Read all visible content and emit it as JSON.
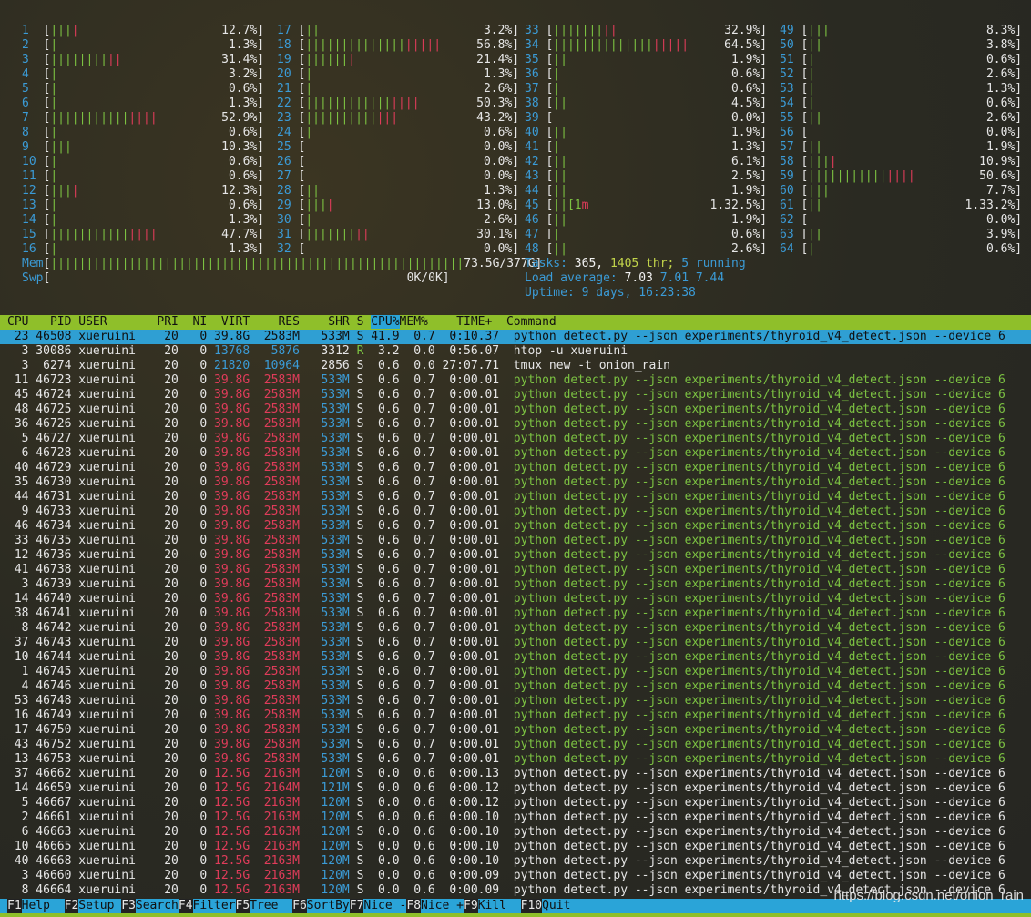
{
  "app_title": "htop",
  "cpu_meters": [
    {
      "id": "1",
      "bars": "||||",
      "pct": "12.7%]"
    },
    {
      "id": "2",
      "bars": "|",
      "pct": "1.3%]"
    },
    {
      "id": "3",
      "bars": "||||||||||",
      "pct": "31.4%]"
    },
    {
      "id": "4",
      "bars": "|",
      "pct": "3.2%]"
    },
    {
      "id": "5",
      "bars": "|",
      "pct": "0.6%]"
    },
    {
      "id": "6",
      "bars": "|",
      "pct": "1.3%]"
    },
    {
      "id": "7",
      "bars": "|||||||||||||||",
      "pct": "52.9%]"
    },
    {
      "id": "8",
      "bars": "|",
      "pct": "0.6%]"
    },
    {
      "id": "9",
      "bars": "|||",
      "pct": "10.3%]"
    },
    {
      "id": "10",
      "bars": "|",
      "pct": "0.6%]"
    },
    {
      "id": "11",
      "bars": "|",
      "pct": "0.6%]"
    },
    {
      "id": "12",
      "bars": "||||",
      "pct": "12.3%]"
    },
    {
      "id": "13",
      "bars": "|",
      "pct": "0.6%]"
    },
    {
      "id": "14",
      "bars": "|",
      "pct": "1.3%]"
    },
    {
      "id": "15",
      "bars": "|||||||||||||||",
      "pct": "47.7%]"
    },
    {
      "id": "16",
      "bars": "|",
      "pct": "1.3%]"
    },
    {
      "id": "17",
      "bars": "||",
      "pct": "3.2%]"
    },
    {
      "id": "18",
      "bars": "|||||||||||||||||||",
      "pct": "56.8%]"
    },
    {
      "id": "19",
      "bars": "|||||||",
      "pct": "21.4%]"
    },
    {
      "id": "20",
      "bars": "|",
      "pct": "1.3%]"
    },
    {
      "id": "21",
      "bars": "|",
      "pct": "2.6%]"
    },
    {
      "id": "22",
      "bars": "||||||||||||||||",
      "pct": "50.3%]"
    },
    {
      "id": "23",
      "bars": "|||||||||||||",
      "pct": "43.2%]"
    },
    {
      "id": "24",
      "bars": "|",
      "pct": "0.6%]"
    },
    {
      "id": "25",
      "bars": "",
      "pct": "0.0%]"
    },
    {
      "id": "26",
      "bars": "",
      "pct": "0.0%]"
    },
    {
      "id": "27",
      "bars": "",
      "pct": "0.0%]"
    },
    {
      "id": "28",
      "bars": "||",
      "pct": "1.3%]"
    },
    {
      "id": "29",
      "bars": "||||",
      "pct": "13.0%]"
    },
    {
      "id": "30",
      "bars": "|",
      "pct": "2.6%]"
    },
    {
      "id": "31",
      "bars": "|||||||||",
      "pct": "30.1%]"
    },
    {
      "id": "32",
      "bars": "",
      "pct": "0.0%]"
    },
    {
      "id": "33",
      "bars": "|||||||||",
      "pct": "32.9%]"
    },
    {
      "id": "34",
      "bars": "|||||||||||||||||||",
      "pct": "64.5%]"
    },
    {
      "id": "35",
      "bars": "||",
      "pct": "1.9%]"
    },
    {
      "id": "36",
      "bars": "|",
      "pct": "0.6%]"
    },
    {
      "id": "37",
      "bars": "|",
      "pct": "0.6%]"
    },
    {
      "id": "38",
      "bars": "||",
      "pct": "4.5%]"
    },
    {
      "id": "39",
      "bars": "",
      "pct": "0.0%]"
    },
    {
      "id": "40",
      "bars": "||",
      "pct": "1.9%]"
    },
    {
      "id": "41",
      "bars": "|",
      "pct": "1.3%]"
    },
    {
      "id": "42",
      "bars": "||",
      "pct": "6.1%]"
    },
    {
      "id": "43",
      "bars": "||",
      "pct": "2.5%]"
    },
    {
      "id": "44",
      "bars": "||",
      "pct": "1.9%]"
    },
    {
      "id": "45",
      "bars": "||[1m",
      "pct": "1.32.5%]"
    },
    {
      "id": "46",
      "bars": "||",
      "pct": "1.9%]"
    },
    {
      "id": "47",
      "bars": "|",
      "pct": "0.6%]"
    },
    {
      "id": "48",
      "bars": "||",
      "pct": "2.6%]"
    },
    {
      "id": "49",
      "bars": "|||",
      "pct": "8.3%]"
    },
    {
      "id": "50",
      "bars": "||",
      "pct": "3.8%]"
    },
    {
      "id": "51",
      "bars": "|",
      "pct": "0.6%]"
    },
    {
      "id": "52",
      "bars": "|",
      "pct": "2.6%]"
    },
    {
      "id": "53",
      "bars": "|",
      "pct": "1.3%]"
    },
    {
      "id": "54",
      "bars": "|",
      "pct": "0.6%]"
    },
    {
      "id": "55",
      "bars": "||",
      "pct": "2.6%]"
    },
    {
      "id": "56",
      "bars": "",
      "pct": "0.0%]"
    },
    {
      "id": "57",
      "bars": "||",
      "pct": "1.9%]"
    },
    {
      "id": "58",
      "bars": "||||",
      "pct": "10.9%]"
    },
    {
      "id": "59",
      "bars": "|||||||||||||||",
      "pct": "50.6%]"
    },
    {
      "id": "60",
      "bars": "|||",
      "pct": "7.7%]"
    },
    {
      "id": "61",
      "bars": "||",
      "pct": "1.33.2%]"
    },
    {
      "id": "62",
      "bars": "",
      "pct": "0.0%]"
    },
    {
      "id": "63",
      "bars": "||",
      "pct": "3.9%]"
    },
    {
      "id": "64",
      "bars": "|",
      "pct": "0.6%]"
    }
  ],
  "mem": {
    "label": "Mem",
    "value": "73.5G/377G]"
  },
  "swp": {
    "label": "Swp",
    "value": "0K/0K]"
  },
  "tasks": {
    "label": "Tasks:",
    "count": "365,",
    "thr": "1405 thr;",
    "running": "5 running"
  },
  "load": {
    "label": "Load average:",
    "l1": "7.03",
    "l5": "7.01",
    "l15": "7.44"
  },
  "uptime": {
    "label": "Uptime:",
    "value": "9 days, 16:23:38"
  },
  "columns": [
    "CPU",
    "PID",
    "USER",
    "PRI",
    "NI",
    "VIRT",
    "RES",
    "SHR",
    "S",
    "CPU%",
    "MEM%",
    "TIME+",
    "Command"
  ],
  "processes": [
    {
      "cpu": "23",
      "pid": "46508",
      "user": "xueruini",
      "pri": "20",
      "ni": "0",
      "virt": "39.8G",
      "res": "2583M",
      "shr": "533M",
      "s": "S",
      "cpup": "41.9",
      "memp": "0.7",
      "time": "0:10.37",
      "cmd": "python detect.py --json experiments/thyroid_v4_detect.json --device 6"
    },
    {
      "cpu": "3",
      "pid": "30086",
      "user": "xueruini",
      "pri": "20",
      "ni": "0",
      "virt": "13768",
      "res": "5876",
      "shr": "3312",
      "s": "R",
      "cpup": "3.2",
      "memp": "0.0",
      "time": "0:56.07",
      "cmd": "htop -u xueruini"
    },
    {
      "cpu": "3",
      "pid": "6274",
      "user": "xueruini",
      "pri": "20",
      "ni": "0",
      "virt": "21820",
      "res": "10964",
      "shr": "2856",
      "s": "S",
      "cpup": "0.6",
      "memp": "0.0",
      "time": "27:07.71",
      "cmd": "tmux new -t onion_rain"
    },
    {
      "cpu": "11",
      "pid": "46723",
      "user": "xueruini",
      "pri": "20",
      "ni": "0",
      "virt": "39.8G",
      "res": "2583M",
      "shr": "533M",
      "s": "S",
      "cpup": "0.6",
      "memp": "0.7",
      "time": "0:00.01",
      "cmd": "python detect.py --json experiments/thyroid_v4_detect.json --device 6"
    },
    {
      "cpu": "45",
      "pid": "46724",
      "user": "xueruini",
      "pri": "20",
      "ni": "0",
      "virt": "39.8G",
      "res": "2583M",
      "shr": "533M",
      "s": "S",
      "cpup": "0.6",
      "memp": "0.7",
      "time": "0:00.01",
      "cmd": "python detect.py --json experiments/thyroid_v4_detect.json --device 6"
    },
    {
      "cpu": "48",
      "pid": "46725",
      "user": "xueruini",
      "pri": "20",
      "ni": "0",
      "virt": "39.8G",
      "res": "2583M",
      "shr": "533M",
      "s": "S",
      "cpup": "0.6",
      "memp": "0.7",
      "time": "0:00.01",
      "cmd": "python detect.py --json experiments/thyroid_v4_detect.json --device 6"
    },
    {
      "cpu": "36",
      "pid": "46726",
      "user": "xueruini",
      "pri": "20",
      "ni": "0",
      "virt": "39.8G",
      "res": "2583M",
      "shr": "533M",
      "s": "S",
      "cpup": "0.6",
      "memp": "0.7",
      "time": "0:00.01",
      "cmd": "python detect.py --json experiments/thyroid_v4_detect.json --device 6"
    },
    {
      "cpu": "5",
      "pid": "46727",
      "user": "xueruini",
      "pri": "20",
      "ni": "0",
      "virt": "39.8G",
      "res": "2583M",
      "shr": "533M",
      "s": "S",
      "cpup": "0.6",
      "memp": "0.7",
      "time": "0:00.01",
      "cmd": "python detect.py --json experiments/thyroid_v4_detect.json --device 6"
    },
    {
      "cpu": "6",
      "pid": "46728",
      "user": "xueruini",
      "pri": "20",
      "ni": "0",
      "virt": "39.8G",
      "res": "2583M",
      "shr": "533M",
      "s": "S",
      "cpup": "0.6",
      "memp": "0.7",
      "time": "0:00.01",
      "cmd": "python detect.py --json experiments/thyroid_v4_detect.json --device 6"
    },
    {
      "cpu": "40",
      "pid": "46729",
      "user": "xueruini",
      "pri": "20",
      "ni": "0",
      "virt": "39.8G",
      "res": "2583M",
      "shr": "533M",
      "s": "S",
      "cpup": "0.6",
      "memp": "0.7",
      "time": "0:00.01",
      "cmd": "python detect.py --json experiments/thyroid_v4_detect.json --device 6"
    },
    {
      "cpu": "35",
      "pid": "46730",
      "user": "xueruini",
      "pri": "20",
      "ni": "0",
      "virt": "39.8G",
      "res": "2583M",
      "shr": "533M",
      "s": "S",
      "cpup": "0.6",
      "memp": "0.7",
      "time": "0:00.01",
      "cmd": "python detect.py --json experiments/thyroid_v4_detect.json --device 6"
    },
    {
      "cpu": "44",
      "pid": "46731",
      "user": "xueruini",
      "pri": "20",
      "ni": "0",
      "virt": "39.8G",
      "res": "2583M",
      "shr": "533M",
      "s": "S",
      "cpup": "0.6",
      "memp": "0.7",
      "time": "0:00.01",
      "cmd": "python detect.py --json experiments/thyroid_v4_detect.json --device 6"
    },
    {
      "cpu": "9",
      "pid": "46733",
      "user": "xueruini",
      "pri": "20",
      "ni": "0",
      "virt": "39.8G",
      "res": "2583M",
      "shr": "533M",
      "s": "S",
      "cpup": "0.6",
      "memp": "0.7",
      "time": "0:00.01",
      "cmd": "python detect.py --json experiments/thyroid_v4_detect.json --device 6"
    },
    {
      "cpu": "46",
      "pid": "46734",
      "user": "xueruini",
      "pri": "20",
      "ni": "0",
      "virt": "39.8G",
      "res": "2583M",
      "shr": "533M",
      "s": "S",
      "cpup": "0.6",
      "memp": "0.7",
      "time": "0:00.01",
      "cmd": "python detect.py --json experiments/thyroid_v4_detect.json --device 6"
    },
    {
      "cpu": "33",
      "pid": "46735",
      "user": "xueruini",
      "pri": "20",
      "ni": "0",
      "virt": "39.8G",
      "res": "2583M",
      "shr": "533M",
      "s": "S",
      "cpup": "0.6",
      "memp": "0.7",
      "time": "0:00.01",
      "cmd": "python detect.py --json experiments/thyroid_v4_detect.json --device 6"
    },
    {
      "cpu": "12",
      "pid": "46736",
      "user": "xueruini",
      "pri": "20",
      "ni": "0",
      "virt": "39.8G",
      "res": "2583M",
      "shr": "533M",
      "s": "S",
      "cpup": "0.6",
      "memp": "0.7",
      "time": "0:00.01",
      "cmd": "python detect.py --json experiments/thyroid_v4_detect.json --device 6"
    },
    {
      "cpu": "41",
      "pid": "46738",
      "user": "xueruini",
      "pri": "20",
      "ni": "0",
      "virt": "39.8G",
      "res": "2583M",
      "shr": "533M",
      "s": "S",
      "cpup": "0.6",
      "memp": "0.7",
      "time": "0:00.01",
      "cmd": "python detect.py --json experiments/thyroid_v4_detect.json --device 6"
    },
    {
      "cpu": "3",
      "pid": "46739",
      "user": "xueruini",
      "pri": "20",
      "ni": "0",
      "virt": "39.8G",
      "res": "2583M",
      "shr": "533M",
      "s": "S",
      "cpup": "0.6",
      "memp": "0.7",
      "time": "0:00.01",
      "cmd": "python detect.py --json experiments/thyroid_v4_detect.json --device 6"
    },
    {
      "cpu": "14",
      "pid": "46740",
      "user": "xueruini",
      "pri": "20",
      "ni": "0",
      "virt": "39.8G",
      "res": "2583M",
      "shr": "533M",
      "s": "S",
      "cpup": "0.6",
      "memp": "0.7",
      "time": "0:00.01",
      "cmd": "python detect.py --json experiments/thyroid_v4_detect.json --device 6"
    },
    {
      "cpu": "38",
      "pid": "46741",
      "user": "xueruini",
      "pri": "20",
      "ni": "0",
      "virt": "39.8G",
      "res": "2583M",
      "shr": "533M",
      "s": "S",
      "cpup": "0.6",
      "memp": "0.7",
      "time": "0:00.01",
      "cmd": "python detect.py --json experiments/thyroid_v4_detect.json --device 6"
    },
    {
      "cpu": "8",
      "pid": "46742",
      "user": "xueruini",
      "pri": "20",
      "ni": "0",
      "virt": "39.8G",
      "res": "2583M",
      "shr": "533M",
      "s": "S",
      "cpup": "0.6",
      "memp": "0.7",
      "time": "0:00.01",
      "cmd": "python detect.py --json experiments/thyroid_v4_detect.json --device 6"
    },
    {
      "cpu": "37",
      "pid": "46743",
      "user": "xueruini",
      "pri": "20",
      "ni": "0",
      "virt": "39.8G",
      "res": "2583M",
      "shr": "533M",
      "s": "S",
      "cpup": "0.6",
      "memp": "0.7",
      "time": "0:00.01",
      "cmd": "python detect.py --json experiments/thyroid_v4_detect.json --device 6"
    },
    {
      "cpu": "10",
      "pid": "46744",
      "user": "xueruini",
      "pri": "20",
      "ni": "0",
      "virt": "39.8G",
      "res": "2583M",
      "shr": "533M",
      "s": "S",
      "cpup": "0.6",
      "memp": "0.7",
      "time": "0:00.01",
      "cmd": "python detect.py --json experiments/thyroid_v4_detect.json --device 6"
    },
    {
      "cpu": "1",
      "pid": "46745",
      "user": "xueruini",
      "pri": "20",
      "ni": "0",
      "virt": "39.8G",
      "res": "2583M",
      "shr": "533M",
      "s": "S",
      "cpup": "0.6",
      "memp": "0.7",
      "time": "0:00.01",
      "cmd": "python detect.py --json experiments/thyroid_v4_detect.json --device 6"
    },
    {
      "cpu": "4",
      "pid": "46746",
      "user": "xueruini",
      "pri": "20",
      "ni": "0",
      "virt": "39.8G",
      "res": "2583M",
      "shr": "533M",
      "s": "S",
      "cpup": "0.6",
      "memp": "0.7",
      "time": "0:00.01",
      "cmd": "python detect.py --json experiments/thyroid_v4_detect.json --device 6"
    },
    {
      "cpu": "53",
      "pid": "46748",
      "user": "xueruini",
      "pri": "20",
      "ni": "0",
      "virt": "39.8G",
      "res": "2583M",
      "shr": "533M",
      "s": "S",
      "cpup": "0.6",
      "memp": "0.7",
      "time": "0:00.01",
      "cmd": "python detect.py --json experiments/thyroid_v4_detect.json --device 6"
    },
    {
      "cpu": "16",
      "pid": "46749",
      "user": "xueruini",
      "pri": "20",
      "ni": "0",
      "virt": "39.8G",
      "res": "2583M",
      "shr": "533M",
      "s": "S",
      "cpup": "0.6",
      "memp": "0.7",
      "time": "0:00.01",
      "cmd": "python detect.py --json experiments/thyroid_v4_detect.json --device 6"
    },
    {
      "cpu": "17",
      "pid": "46750",
      "user": "xueruini",
      "pri": "20",
      "ni": "0",
      "virt": "39.8G",
      "res": "2583M",
      "shr": "533M",
      "s": "S",
      "cpup": "0.6",
      "memp": "0.7",
      "time": "0:00.01",
      "cmd": "python detect.py --json experiments/thyroid_v4_detect.json --device 6"
    },
    {
      "cpu": "43",
      "pid": "46752",
      "user": "xueruini",
      "pri": "20",
      "ni": "0",
      "virt": "39.8G",
      "res": "2583M",
      "shr": "533M",
      "s": "S",
      "cpup": "0.6",
      "memp": "0.7",
      "time": "0:00.01",
      "cmd": "python detect.py --json experiments/thyroid_v4_detect.json --device 6"
    },
    {
      "cpu": "13",
      "pid": "46753",
      "user": "xueruini",
      "pri": "20",
      "ni": "0",
      "virt": "39.8G",
      "res": "2583M",
      "shr": "533M",
      "s": "S",
      "cpup": "0.6",
      "memp": "0.7",
      "time": "0:00.01",
      "cmd": "python detect.py --json experiments/thyroid_v4_detect.json --device 6"
    },
    {
      "cpu": "37",
      "pid": "46662",
      "user": "xueruini",
      "pri": "20",
      "ni": "0",
      "virt": "12.5G",
      "res": "2163M",
      "shr": "120M",
      "s": "S",
      "cpup": "0.0",
      "memp": "0.6",
      "time": "0:00.13",
      "cmd": "python detect.py --json experiments/thyroid_v4_detect.json --device 6"
    },
    {
      "cpu": "14",
      "pid": "46659",
      "user": "xueruini",
      "pri": "20",
      "ni": "0",
      "virt": "12.5G",
      "res": "2164M",
      "shr": "121M",
      "s": "S",
      "cpup": "0.0",
      "memp": "0.6",
      "time": "0:00.12",
      "cmd": "python detect.py --json experiments/thyroid_v4_detect.json --device 6"
    },
    {
      "cpu": "5",
      "pid": "46667",
      "user": "xueruini",
      "pri": "20",
      "ni": "0",
      "virt": "12.5G",
      "res": "2163M",
      "shr": "120M",
      "s": "S",
      "cpup": "0.0",
      "memp": "0.6",
      "time": "0:00.12",
      "cmd": "python detect.py --json experiments/thyroid_v4_detect.json --device 6"
    },
    {
      "cpu": "2",
      "pid": "46661",
      "user": "xueruini",
      "pri": "20",
      "ni": "0",
      "virt": "12.5G",
      "res": "2163M",
      "shr": "120M",
      "s": "S",
      "cpup": "0.0",
      "memp": "0.6",
      "time": "0:00.10",
      "cmd": "python detect.py --json experiments/thyroid_v4_detect.json --device 6"
    },
    {
      "cpu": "6",
      "pid": "46663",
      "user": "xueruini",
      "pri": "20",
      "ni": "0",
      "virt": "12.5G",
      "res": "2163M",
      "shr": "120M",
      "s": "S",
      "cpup": "0.0",
      "memp": "0.6",
      "time": "0:00.10",
      "cmd": "python detect.py --json experiments/thyroid_v4_detect.json --device 6"
    },
    {
      "cpu": "10",
      "pid": "46665",
      "user": "xueruini",
      "pri": "20",
      "ni": "0",
      "virt": "12.5G",
      "res": "2163M",
      "shr": "120M",
      "s": "S",
      "cpup": "0.0",
      "memp": "0.6",
      "time": "0:00.10",
      "cmd": "python detect.py --json experiments/thyroid_v4_detect.json --device 6"
    },
    {
      "cpu": "40",
      "pid": "46668",
      "user": "xueruini",
      "pri": "20",
      "ni": "0",
      "virt": "12.5G",
      "res": "2163M",
      "shr": "120M",
      "s": "S",
      "cpup": "0.0",
      "memp": "0.6",
      "time": "0:00.10",
      "cmd": "python detect.py --json experiments/thyroid_v4_detect.json --device 6"
    },
    {
      "cpu": "3",
      "pid": "46660",
      "user": "xueruini",
      "pri": "20",
      "ni": "0",
      "virt": "12.5G",
      "res": "2163M",
      "shr": "120M",
      "s": "S",
      "cpup": "0.0",
      "memp": "0.6",
      "time": "0:00.09",
      "cmd": "python detect.py --json experiments/thyroid_v4_detect.json --device 6"
    },
    {
      "cpu": "8",
      "pid": "46664",
      "user": "xueruini",
      "pri": "20",
      "ni": "0",
      "virt": "12.5G",
      "res": "2163M",
      "shr": "120M",
      "s": "S",
      "cpup": "0.0",
      "memp": "0.6",
      "time": "0:00.09",
      "cmd": "python detect.py --json experiments/thyroid_v4_detect.json --device 6"
    }
  ],
  "footer": [
    {
      "key": "F1",
      "label": "Help"
    },
    {
      "key": "F2",
      "label": "Setup"
    },
    {
      "key": "F3",
      "label": "Search"
    },
    {
      "key": "F4",
      "label": "Filter"
    },
    {
      "key": "F5",
      "label": "Tree"
    },
    {
      "key": "F6",
      "label": "SortBy"
    },
    {
      "key": "F7",
      "label": "Nice -"
    },
    {
      "key": "F8",
      "label": "Nice +"
    },
    {
      "key": "F9",
      "label": "Kill"
    },
    {
      "key": "F10",
      "label": "Quit"
    }
  ],
  "watermark": "https://blog.csdn.net/onion_rain",
  "colors": {
    "header_bg": "#8fbf2a",
    "selected_row_bg": "#2f9fd3",
    "red_value": "#e03c5a",
    "cmd_green": "#7cc242"
  }
}
